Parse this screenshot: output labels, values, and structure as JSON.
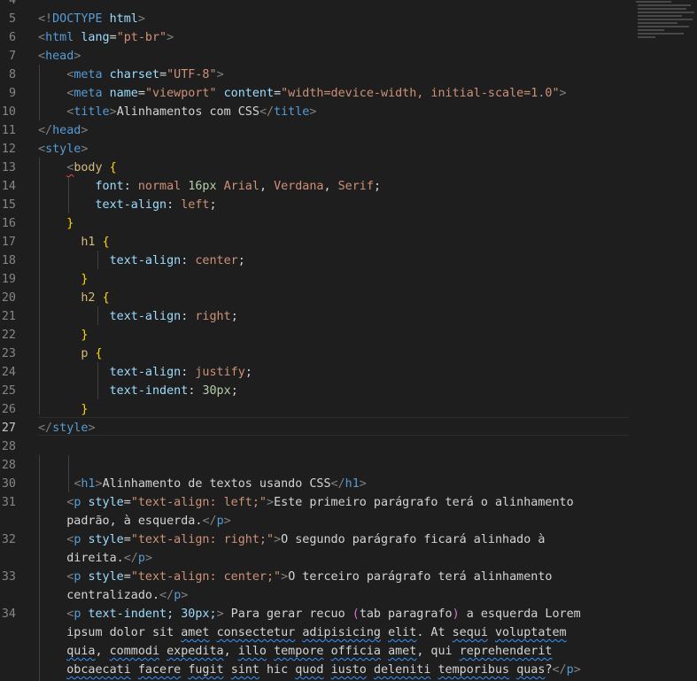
{
  "editor": {
    "language": "html",
    "active_line": "27",
    "lines": [
      {
        "n": "4",
        "tokens": []
      },
      {
        "n": "5",
        "tokens": [
          [
            "t-br",
            "<!"
          ],
          [
            "t-tag",
            "DOCTYPE"
          ],
          [
            "t-txt",
            " "
          ],
          [
            "t-attr",
            "html"
          ],
          [
            "t-br",
            ">"
          ]
        ]
      },
      {
        "n": "6",
        "tokens": [
          [
            "t-br",
            "<"
          ],
          [
            "t-tag",
            "html"
          ],
          [
            "t-txt",
            " "
          ],
          [
            "t-attr",
            "lang"
          ],
          [
            "t-pun",
            "="
          ],
          [
            "t-str",
            "\"pt-br\""
          ],
          [
            "t-br",
            ">"
          ]
        ]
      },
      {
        "n": "7",
        "tokens": [
          [
            "t-br",
            "<"
          ],
          [
            "t-tag",
            "head"
          ],
          [
            "t-br",
            ">"
          ]
        ]
      },
      {
        "n": "8",
        "tokens": [
          [
            "t-txt",
            "    "
          ],
          [
            "t-br",
            "<"
          ],
          [
            "t-tag",
            "meta"
          ],
          [
            "t-txt",
            " "
          ],
          [
            "t-attr",
            "charset"
          ],
          [
            "t-pun",
            "="
          ],
          [
            "t-str",
            "\"UTF-8\""
          ],
          [
            "t-br",
            ">"
          ]
        ]
      },
      {
        "n": "9",
        "tokens": [
          [
            "t-txt",
            "    "
          ],
          [
            "t-br",
            "<"
          ],
          [
            "t-tag",
            "meta"
          ],
          [
            "t-txt",
            " "
          ],
          [
            "t-attr",
            "name"
          ],
          [
            "t-pun",
            "="
          ],
          [
            "t-str",
            "\"viewport\""
          ],
          [
            "t-txt",
            " "
          ],
          [
            "t-attr",
            "content"
          ],
          [
            "t-pun",
            "="
          ],
          [
            "t-str",
            "\"width=device-width, initial-scale=1.0\""
          ],
          [
            "t-br",
            ">"
          ]
        ]
      },
      {
        "n": "10",
        "tokens": [
          [
            "t-txt",
            "    "
          ],
          [
            "t-br",
            "<"
          ],
          [
            "t-tag",
            "title"
          ],
          [
            "t-br",
            ">"
          ],
          [
            "t-txt",
            "Alinhamentos com CSS"
          ],
          [
            "t-br",
            "</"
          ],
          [
            "t-tag",
            "title"
          ],
          [
            "t-br",
            ">"
          ]
        ]
      },
      {
        "n": "11",
        "tokens": [
          [
            "t-br",
            "</"
          ],
          [
            "t-tag",
            "head"
          ],
          [
            "t-br",
            ">"
          ]
        ]
      },
      {
        "n": "12",
        "tokens": [
          [
            "t-br",
            "<"
          ],
          [
            "t-tag",
            "style"
          ],
          [
            "t-br",
            ">"
          ]
        ]
      },
      {
        "n": "13",
        "tokens": [
          [
            "t-txt",
            "    "
          ],
          [
            "t-br squig-red",
            "<"
          ],
          [
            "t-sel",
            "body"
          ],
          [
            "t-txt",
            " "
          ],
          [
            "t-brace",
            "{"
          ]
        ]
      },
      {
        "n": "14",
        "tokens": [
          [
            "t-txt",
            "        "
          ],
          [
            "t-prop",
            "font"
          ],
          [
            "t-pun",
            ": "
          ],
          [
            "t-val",
            "normal "
          ],
          [
            "t-num",
            "16px"
          ],
          [
            "t-val",
            " Arial"
          ],
          [
            "t-pun",
            ", "
          ],
          [
            "t-val",
            "Verdana"
          ],
          [
            "t-pun",
            ", "
          ],
          [
            "t-val",
            "Serif"
          ],
          [
            "t-pun",
            ";"
          ]
        ]
      },
      {
        "n": "15",
        "tokens": [
          [
            "t-txt",
            "        "
          ],
          [
            "t-prop",
            "text-align"
          ],
          [
            "t-pun",
            ": "
          ],
          [
            "t-val",
            "left"
          ],
          [
            "t-pun",
            ";"
          ]
        ]
      },
      {
        "n": "16",
        "tokens": [
          [
            "t-txt",
            "    "
          ],
          [
            "t-brace",
            "}"
          ]
        ]
      },
      {
        "n": "17",
        "tokens": [
          [
            "t-txt",
            "      "
          ],
          [
            "t-sel",
            "h1"
          ],
          [
            "t-txt",
            " "
          ],
          [
            "t-brace",
            "{"
          ]
        ]
      },
      {
        "n": "18",
        "tokens": [
          [
            "t-txt",
            "          "
          ],
          [
            "t-prop",
            "text-align"
          ],
          [
            "t-pun",
            ": "
          ],
          [
            "t-val",
            "center"
          ],
          [
            "t-pun",
            ";"
          ]
        ]
      },
      {
        "n": "19",
        "tokens": [
          [
            "t-txt",
            "      "
          ],
          [
            "t-brace",
            "}"
          ]
        ]
      },
      {
        "n": "20",
        "tokens": [
          [
            "t-txt",
            "      "
          ],
          [
            "t-sel",
            "h2"
          ],
          [
            "t-txt",
            " "
          ],
          [
            "t-brace",
            "{"
          ]
        ]
      },
      {
        "n": "21",
        "tokens": [
          [
            "t-txt",
            "          "
          ],
          [
            "t-prop",
            "text-align"
          ],
          [
            "t-pun",
            ": "
          ],
          [
            "t-val",
            "right"
          ],
          [
            "t-pun",
            ";"
          ]
        ]
      },
      {
        "n": "22",
        "tokens": [
          [
            "t-txt",
            "      "
          ],
          [
            "t-brace",
            "}"
          ]
        ]
      },
      {
        "n": "23",
        "tokens": [
          [
            "t-txt",
            "      "
          ],
          [
            "t-sel",
            "p"
          ],
          [
            "t-txt",
            " "
          ],
          [
            "t-brace",
            "{"
          ]
        ]
      },
      {
        "n": "24",
        "tokens": [
          [
            "t-txt",
            "          "
          ],
          [
            "t-prop",
            "text-align"
          ],
          [
            "t-pun",
            ": "
          ],
          [
            "t-val",
            "justify"
          ],
          [
            "t-pun",
            ";"
          ]
        ]
      },
      {
        "n": "25",
        "tokens": [
          [
            "t-txt",
            "          "
          ],
          [
            "t-prop",
            "text-indent"
          ],
          [
            "t-pun",
            ": "
          ],
          [
            "t-num",
            "30px"
          ],
          [
            "t-pun",
            ";"
          ]
        ]
      },
      {
        "n": "26",
        "tokens": [
          [
            "t-txt",
            "      "
          ],
          [
            "t-brace",
            "}"
          ]
        ]
      },
      {
        "n": "27",
        "tokens": [
          [
            "t-br",
            "</"
          ],
          [
            "t-tag",
            "style"
          ],
          [
            "t-br",
            ">"
          ]
        ]
      },
      {
        "n": "28",
        "tokens": []
      },
      {
        "n": "28",
        "tokens": []
      },
      {
        "n": "30",
        "tokens": [
          [
            "t-txt",
            "     "
          ],
          [
            "t-br",
            "<"
          ],
          [
            "t-tag",
            "h1"
          ],
          [
            "t-br",
            ">"
          ],
          [
            "t-txt",
            "Alinhamento de textos usando CSS"
          ],
          [
            "t-br",
            "</"
          ],
          [
            "t-tag",
            "h1"
          ],
          [
            "t-br",
            ">"
          ]
        ]
      },
      {
        "n": "31",
        "tokens": [
          [
            "t-txt",
            "    "
          ],
          [
            "t-br",
            "<"
          ],
          [
            "t-tag",
            "p"
          ],
          [
            "t-txt",
            " "
          ],
          [
            "t-attr",
            "style"
          ],
          [
            "t-pun",
            "="
          ],
          [
            "t-str",
            "\"text-align: left;\""
          ],
          [
            "t-br",
            ">"
          ],
          [
            "t-txt",
            "Este primeiro parágrafo terá o alinhamento"
          ]
        ]
      },
      {
        "n": "",
        "tokens": [
          [
            "t-txt",
            "    padrão, à esquerda."
          ],
          [
            "t-br",
            "</"
          ],
          [
            "t-tag",
            "p"
          ],
          [
            "t-br",
            ">"
          ]
        ]
      },
      {
        "n": "32",
        "tokens": [
          [
            "t-txt",
            "    "
          ],
          [
            "t-br",
            "<"
          ],
          [
            "t-tag",
            "p"
          ],
          [
            "t-txt",
            " "
          ],
          [
            "t-attr",
            "style"
          ],
          [
            "t-pun",
            "="
          ],
          [
            "t-str",
            "\"text-align: right;\""
          ],
          [
            "t-br",
            ">"
          ],
          [
            "t-txt",
            "O segundo parágrafo ficará alinhado à"
          ]
        ]
      },
      {
        "n": "",
        "tokens": [
          [
            "t-txt",
            "    direita."
          ],
          [
            "t-br",
            "</"
          ],
          [
            "t-tag",
            "p"
          ],
          [
            "t-br",
            ">"
          ]
        ]
      },
      {
        "n": "33",
        "tokens": [
          [
            "t-txt",
            "    "
          ],
          [
            "t-br",
            "<"
          ],
          [
            "t-tag",
            "p"
          ],
          [
            "t-txt",
            " "
          ],
          [
            "t-attr",
            "style"
          ],
          [
            "t-pun",
            "="
          ],
          [
            "t-str",
            "\"text-align: center;\""
          ],
          [
            "t-br",
            ">"
          ],
          [
            "t-txt",
            "O terceiro parágrafo terá alinhamento"
          ]
        ]
      },
      {
        "n": "",
        "tokens": [
          [
            "t-txt",
            "    centralizado."
          ],
          [
            "t-br",
            "</"
          ],
          [
            "t-tag",
            "p"
          ],
          [
            "t-br",
            ">"
          ]
        ]
      },
      {
        "n": "34",
        "tokens": [
          [
            "t-txt",
            "    "
          ],
          [
            "t-br",
            "<"
          ],
          [
            "t-tag",
            "p"
          ],
          [
            "t-txt",
            " "
          ],
          [
            "t-attr",
            "text-indent;"
          ],
          [
            "t-txt",
            " "
          ],
          [
            "t-attr",
            "30px;"
          ],
          [
            "t-br",
            ">"
          ],
          [
            "t-txt",
            " Para gerar recuo "
          ],
          [
            "t-paren",
            "("
          ],
          [
            "t-txt",
            "tab paragrafo"
          ],
          [
            "t-paren",
            ")"
          ],
          [
            "t-txt",
            " a esquerda Lorem"
          ]
        ]
      },
      {
        "n": "",
        "tokens": [
          [
            "t-txt",
            "    ipsum dolor sit "
          ],
          [
            "t-txt squig",
            "amet"
          ],
          [
            "t-txt",
            " "
          ],
          [
            "t-txt squig",
            "consectetur"
          ],
          [
            "t-txt",
            " "
          ],
          [
            "t-txt squig",
            "adipisicing"
          ],
          [
            "t-txt",
            " "
          ],
          [
            "t-txt squig",
            "elit"
          ],
          [
            "t-txt",
            ". At "
          ],
          [
            "t-txt squig",
            "sequi"
          ],
          [
            "t-txt",
            " "
          ],
          [
            "t-txt squig",
            "voluptatem"
          ]
        ]
      },
      {
        "n": "",
        "tokens": [
          [
            "t-txt",
            "    "
          ],
          [
            "t-txt squig",
            "quia"
          ],
          [
            "t-txt",
            ", "
          ],
          [
            "t-txt squig",
            "commodi"
          ],
          [
            "t-txt",
            " "
          ],
          [
            "t-txt squig",
            "expedita"
          ],
          [
            "t-txt",
            ", "
          ],
          [
            "t-txt squig",
            "illo"
          ],
          [
            "t-txt",
            " "
          ],
          [
            "t-txt squig",
            "tempore"
          ],
          [
            "t-txt",
            " "
          ],
          [
            "t-txt squig",
            "officia"
          ],
          [
            "t-txt",
            " "
          ],
          [
            "t-txt squig",
            "amet"
          ],
          [
            "t-txt",
            ", qui "
          ],
          [
            "t-txt squig",
            "reprehenderit"
          ]
        ]
      },
      {
        "n": "",
        "tokens": [
          [
            "t-txt",
            "    "
          ],
          [
            "t-txt squig",
            "obcaecati"
          ],
          [
            "t-txt",
            " "
          ],
          [
            "t-txt squig",
            "facere"
          ],
          [
            "t-txt",
            " "
          ],
          [
            "t-txt squig",
            "fugit"
          ],
          [
            "t-txt",
            " "
          ],
          [
            "t-txt squig",
            "sint"
          ],
          [
            "t-txt",
            " hic "
          ],
          [
            "t-txt squig",
            "quod"
          ],
          [
            "t-txt",
            " "
          ],
          [
            "t-txt squig",
            "iusto"
          ],
          [
            "t-txt",
            " "
          ],
          [
            "t-txt squig",
            "deleniti"
          ],
          [
            "t-txt",
            " "
          ],
          [
            "t-txt squig",
            "temporibus"
          ],
          [
            "t-txt",
            " "
          ],
          [
            "t-txt squig",
            "quas"
          ],
          [
            "t-txt",
            "?"
          ],
          [
            "t-br",
            "</"
          ],
          [
            "t-tag",
            "p"
          ],
          [
            "t-br",
            ">"
          ]
        ]
      }
    ]
  },
  "colors": {
    "background": "#1e1e1e",
    "line_number": "#858585",
    "tag": "#569cd6",
    "attribute": "#9cdcfe",
    "string": "#ce9178",
    "selector": "#d7ba7d",
    "brace": "#ffd700"
  }
}
